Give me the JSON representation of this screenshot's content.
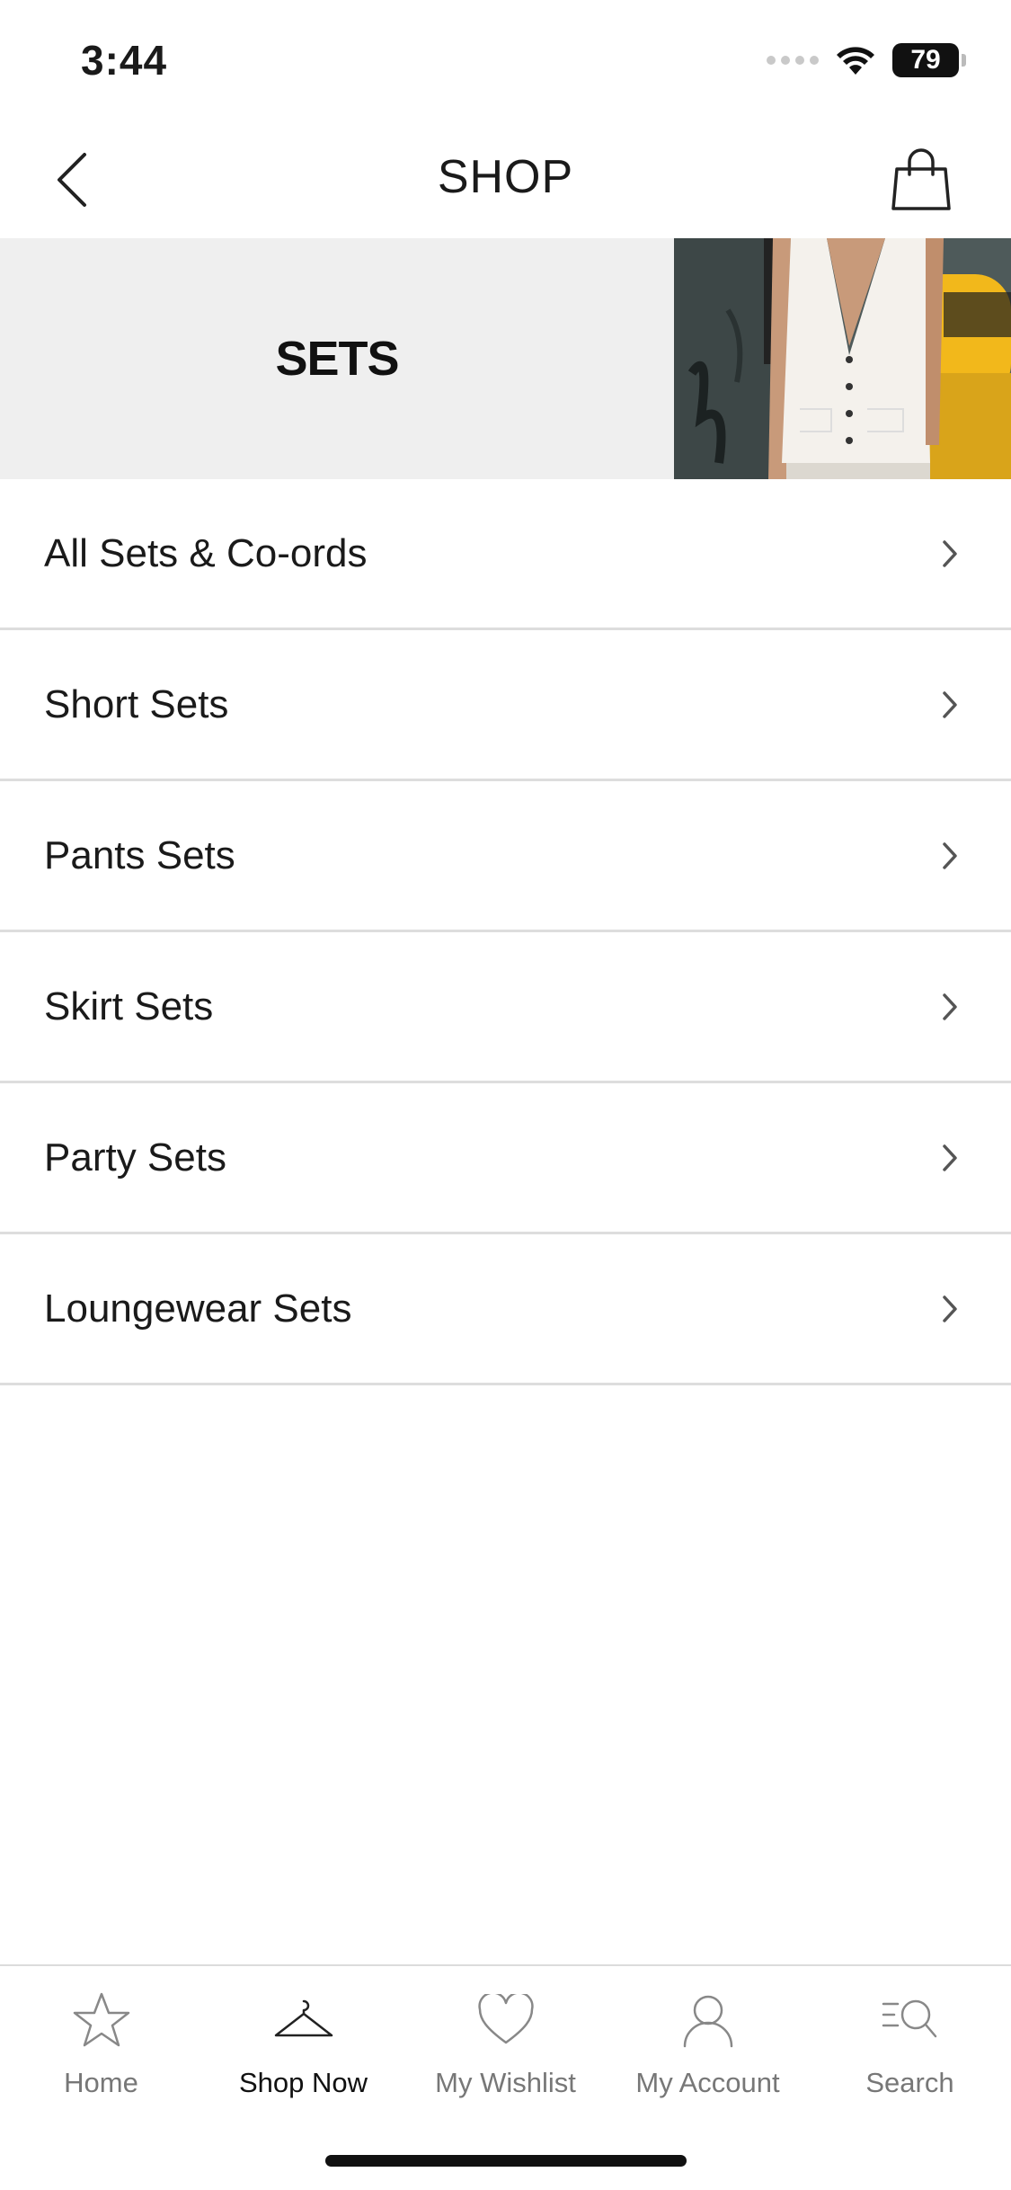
{
  "status_bar": {
    "time": "3:44",
    "battery": "79"
  },
  "header": {
    "title": "SHOP"
  },
  "banner": {
    "title": "SETS"
  },
  "categories": [
    {
      "label": "All Sets & Co-ords"
    },
    {
      "label": "Short Sets"
    },
    {
      "label": "Pants Sets"
    },
    {
      "label": "Skirt Sets"
    },
    {
      "label": "Party Sets"
    },
    {
      "label": "Loungewear Sets"
    }
  ],
  "tabbar": {
    "items": [
      {
        "label": "Home",
        "icon": "star-icon"
      },
      {
        "label": "Shop Now",
        "icon": "hanger-icon",
        "active": true
      },
      {
        "label": "My Wishlist",
        "icon": "heart-icon"
      },
      {
        "label": "My Account",
        "icon": "user-icon"
      },
      {
        "label": "Search",
        "icon": "search-icon"
      }
    ]
  },
  "colors": {
    "banner_bg": "#efefef",
    "divider": "#dddddd",
    "inactive_tab": "#777777",
    "active_tab": "#111111"
  }
}
